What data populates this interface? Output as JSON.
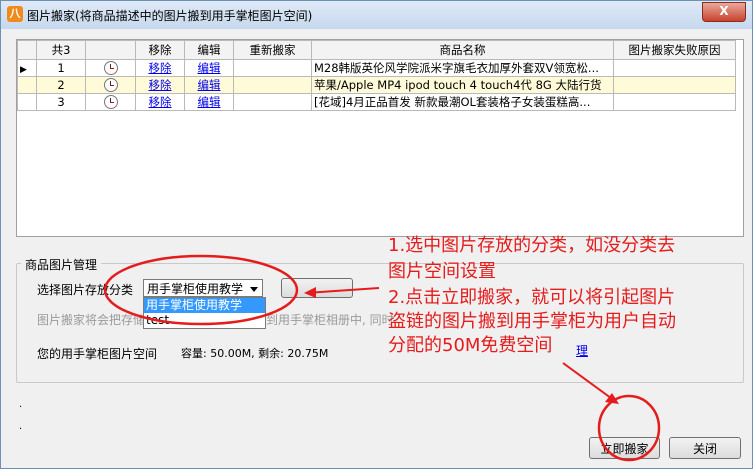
{
  "window": {
    "title": "图片搬家(将商品描述中的图片搬到用手掌柜图片空间)",
    "app_icon": "app-icon",
    "close_label": "X"
  },
  "grid": {
    "headers": [
      "共3",
      "",
      "移除",
      "编辑",
      "重新搬家",
      "商品名称",
      "图片搬家失败原因"
    ],
    "rows": [
      {
        "num": "1",
        "remove": "移除",
        "edit": "编辑",
        "name": "M28韩版英伦风学院派米字旗毛衣加厚外套双V领宽松..."
      },
      {
        "num": "2",
        "remove": "移除",
        "edit": "编辑",
        "name": "苹果/Apple MP4 ipod touch 4 touch4代 8G 大陆行货"
      },
      {
        "num": "3",
        "remove": "移除",
        "edit": "编辑",
        "name": "[花域]4月正品首发 新款最潮OL套装格子女装蛋糕高..."
      }
    ]
  },
  "group": {
    "title": "商品图片管理",
    "category_label": "选择图片存放分类",
    "category_value": "用手掌柜使用教学",
    "category_options": [
      "用手掌柜使用教学",
      "test"
    ],
    "hint_left": "图片搬家将会把存储",
    "hint_right": "到用手掌柜相册中, 同时",
    "space_label": "您的用手掌柜图片空间",
    "capacity_text": "容量: 50.00M, 剩余: 20.75M",
    "link_tail": "理"
  },
  "buttons": {
    "move": "立即搬家",
    "close": "关闭"
  },
  "annotation": {
    "line1": "1.选中图片存放的分类，如没分类去",
    "line2": "图片空间设置",
    "line3": "2.点击立即搬家，就可以将引起图片",
    "line4": "盗链的图片搬到用手掌柜为用户自动",
    "line5": "分配的50M免费空间",
    "color": "#e51c1c"
  }
}
